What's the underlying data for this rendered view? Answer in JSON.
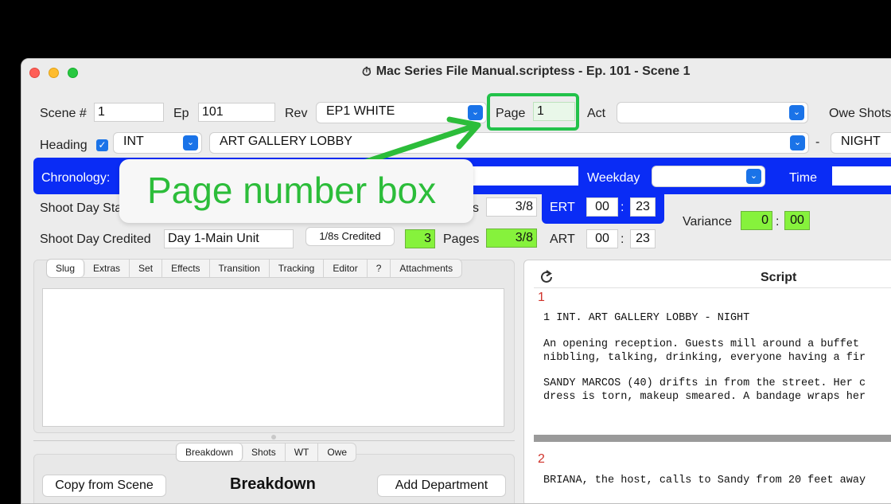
{
  "window": {
    "title": "Mac Series File Manual.scriptess - Ep. 101 - Scene 1",
    "doc_icon": "stopwatch-icon"
  },
  "row1": {
    "scene_label": "Scene #",
    "scene_value": "1",
    "ep_label": "Ep",
    "ep_value": "101",
    "rev_label": "Rev",
    "rev_value": "EP1 WHITE",
    "page_label": "Page",
    "page_value": "1",
    "act_label": "Act",
    "act_value": "",
    "owe_label": "Owe Shots"
  },
  "row2": {
    "heading_label": "Heading",
    "heading_checked": true,
    "intext_value": "INT",
    "location_value": "ART GALLERY LOBBY",
    "dash": "-",
    "tod_value": "NIGHT"
  },
  "chrono": {
    "chronology_label": "Chronology:",
    "weekday_label": "Weekday",
    "time_label": "Time"
  },
  "shoot": {
    "stat_label_partial": "Shoot Day Sta",
    "pages_label_partial": "s",
    "pages_value": "3/8",
    "ert_label": "ERT",
    "ert_min": "00",
    "ert_sec": "23",
    "variance_label": "Variance",
    "variance_min": "0",
    "variance_sec": "00",
    "credited_label": "Shoot Day Credited",
    "credited_value": "Day 1-Main Unit",
    "eighths_button": "1/8s Credited",
    "eighths_value": "3",
    "pages2_label": "Pages",
    "pages2_value": "3/8",
    "art_label": "ART",
    "art_min": "00",
    "art_sec": "23",
    "colon": ":"
  },
  "annotation": {
    "text": "Page number box",
    "color": "#2cbd3a"
  },
  "slug_tabs": [
    "Slug",
    "Extras",
    "Set",
    "Effects",
    "Transition",
    "Tracking",
    "Editor",
    "?",
    "Attachments"
  ],
  "bottom_tabs": [
    "Breakdown",
    "Shots",
    "WT",
    "Owe"
  ],
  "breakdown": {
    "copy_button": "Copy from Scene",
    "title": "Breakdown",
    "add_button": "Add Department"
  },
  "script": {
    "title": "Script",
    "refresh_icon": "refresh-icon",
    "scene1_no": "1",
    "scene1_heading": "1 INT. ART GALLERY LOBBY - NIGHT",
    "scene1_p1a": "An opening reception. Guests mill around a buffet",
    "scene1_p1b": "nibbling, talking, drinking, everyone having a fir",
    "scene1_p2a": "SANDY MARCOS (40) drifts in from the street. Her c",
    "scene1_p2b": "dress is torn, makeup smeared. A bandage wraps her",
    "scene2_no": "2",
    "scene2_p1": "BRIANA, the host, calls to Sandy from 20 feet away"
  },
  "colors": {
    "accent_blue": "#0a2cf5",
    "highlight_green": "#86f23c",
    "popup_blue": "#1a73e8"
  }
}
